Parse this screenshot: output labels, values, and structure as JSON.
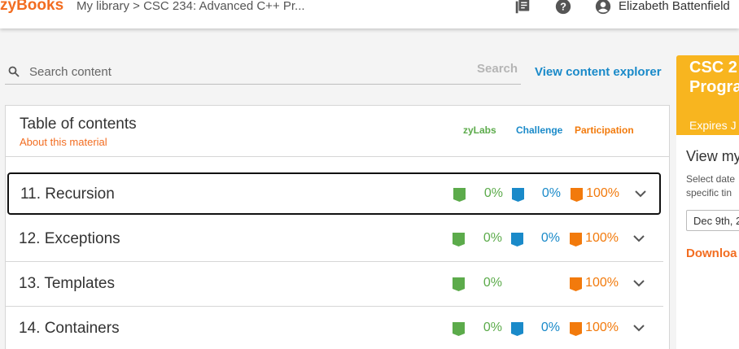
{
  "header": {
    "logo": "zyBooks",
    "breadcrumb": "My library > CSC 234: Advanced C++ Pr...",
    "user_name": "Elizabeth Battenfield"
  },
  "search": {
    "placeholder": "Search content",
    "button": "Search",
    "explorer_link": "View content explorer"
  },
  "toc": {
    "title": "Table of contents",
    "about": "About this material",
    "legend": {
      "zylabs": "zyLabs",
      "challenge": "Challenge",
      "participation": "Participation"
    },
    "chapters": [
      {
        "title": "11. Recursion",
        "zylabs": "0%",
        "challenge": "0%",
        "participation": "100%"
      },
      {
        "title": "12. Exceptions",
        "zylabs": "0%",
        "challenge": "0%",
        "participation": "100%"
      },
      {
        "title": "13. Templates",
        "zylabs": "0%",
        "participation": "100%"
      },
      {
        "title": "14. Containers",
        "zylabs": "0%",
        "challenge": "0%",
        "participation": "100%"
      }
    ]
  },
  "side": {
    "code": "CSC 2",
    "code2": "Progra",
    "expires": "Expires J",
    "view": "View my",
    "select1": "Select date",
    "select2": "specific tin",
    "date": "Dec 9th, 2",
    "download": "Downloa"
  },
  "colors": {
    "zylabs": "#5cab4b",
    "challenge": "#1a8ac9",
    "participation": "#f27a0c",
    "accent": "#f26d21",
    "card": "#f8b51f"
  }
}
